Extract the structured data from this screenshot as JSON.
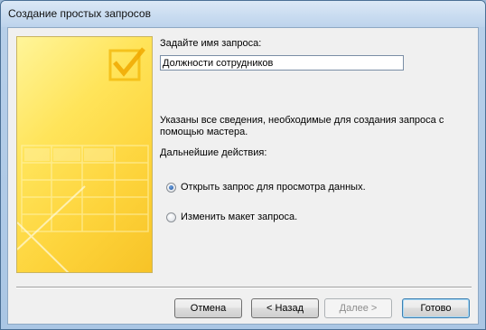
{
  "window": {
    "title": "Создание простых запросов"
  },
  "prompt": {
    "label": "Задайте имя запроса:"
  },
  "query_name": {
    "value": "Должности сотрудников",
    "placeholder": ""
  },
  "info": {
    "text": "Указаны все сведения, необходимые для создания запроса с помощью мастера."
  },
  "next_actions": {
    "label": "Дальнейшие действия:",
    "options": [
      {
        "label": "Открыть запрос для просмотра данных.",
        "selected": true
      },
      {
        "label": "Изменить макет запроса.",
        "selected": false
      }
    ]
  },
  "buttons": {
    "cancel": "Отмена",
    "back": "< Назад",
    "next": "Далее >",
    "finish": "Готово"
  },
  "colors": {
    "art_yellow": "#fdd33a",
    "window_frame": "#aac6e4"
  }
}
